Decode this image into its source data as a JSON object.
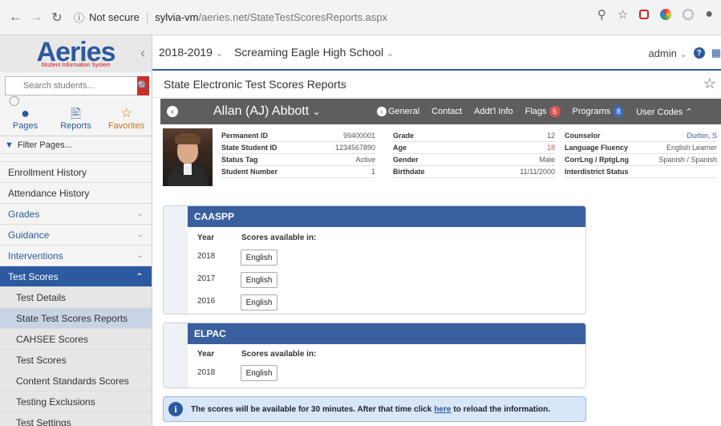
{
  "browser": {
    "security": "Not secure",
    "host": "sylvia-vm",
    "path": "/aeries.net/StateTestScoresReports.aspx"
  },
  "logo": {
    "name": "Aeries",
    "sub": "Student Information System"
  },
  "search": {
    "placeholder": "Search students..."
  },
  "sidebar_tabs": [
    "Pages",
    "Reports",
    "Favorites"
  ],
  "filter_label": "Filter Pages...",
  "sidebar_items": [
    {
      "label": "Enrollment History",
      "type": "plain"
    },
    {
      "label": "Attendance History",
      "type": "plain"
    },
    {
      "label": "Grades",
      "type": "cat"
    },
    {
      "label": "Guidance",
      "type": "cat"
    },
    {
      "label": "Interventions",
      "type": "cat"
    },
    {
      "label": "Test Scores",
      "type": "active"
    },
    {
      "label": "Test Details",
      "type": "sub"
    },
    {
      "label": "State Test Scores Reports",
      "type": "sub-selected"
    },
    {
      "label": "CAHSEE Scores",
      "type": "sub"
    },
    {
      "label": "Test Scores",
      "type": "sub"
    },
    {
      "label": "Content Standards Scores",
      "type": "sub"
    },
    {
      "label": "Testing Exclusions",
      "type": "sub"
    },
    {
      "label": "Test Settings",
      "type": "sub"
    }
  ],
  "topbar": {
    "year": "2018-2019",
    "school": "Screaming Eagle High School",
    "user": "admin"
  },
  "page_title": "State Electronic Test Scores Reports",
  "student": {
    "name": "Allan (AJ) Abbott",
    "nav": {
      "general": "General",
      "contact": "Contact",
      "addl": "Addt'l Info",
      "flags": "Flags",
      "flags_count": "5",
      "programs": "Programs",
      "programs_count": "8",
      "user_codes": "User Codes"
    },
    "col1": [
      {
        "label": "Permanent ID",
        "value": "99400001"
      },
      {
        "label": "State Student ID",
        "value": "1234567890"
      },
      {
        "label": "Status Tag",
        "value": "Active"
      },
      {
        "label": "Student Number",
        "value": "1"
      }
    ],
    "col2": [
      {
        "label": "Grade",
        "value": "12"
      },
      {
        "label": "Age",
        "value": "18"
      },
      {
        "label": "Gender",
        "value": "Male"
      },
      {
        "label": "Birthdate",
        "value": "11/11/2000"
      }
    ],
    "col3": [
      {
        "label": "Counselor",
        "value": "Durbin, S"
      },
      {
        "label": "Language Fluency",
        "value": "English Learner"
      },
      {
        "label": "CorrLng / RptgLng",
        "value": "Spanish / Spanish"
      },
      {
        "label": "Interdistrict Status",
        "value": ""
      }
    ]
  },
  "caaspp": {
    "title": "CAASPP",
    "year_hdr": "Year",
    "scores_hdr": "Scores available in:",
    "rows": [
      {
        "year": "2018",
        "lang": "English"
      },
      {
        "year": "2017",
        "lang": "English"
      },
      {
        "year": "2016",
        "lang": "English"
      }
    ]
  },
  "elpac": {
    "title": "ELPAC",
    "year_hdr": "Year",
    "scores_hdr": "Scores available in:",
    "rows": [
      {
        "year": "2018",
        "lang": "English"
      }
    ]
  },
  "notice": {
    "before": "The scores will be available for 30 minutes. After that time click",
    "link": "here",
    "after": "to reload the information."
  },
  "colors": {
    "brand": "#2c5aa0",
    "panel_head": "#3a5f9e",
    "student_bar": "#5e5e5e",
    "alert": "#d9534f"
  }
}
